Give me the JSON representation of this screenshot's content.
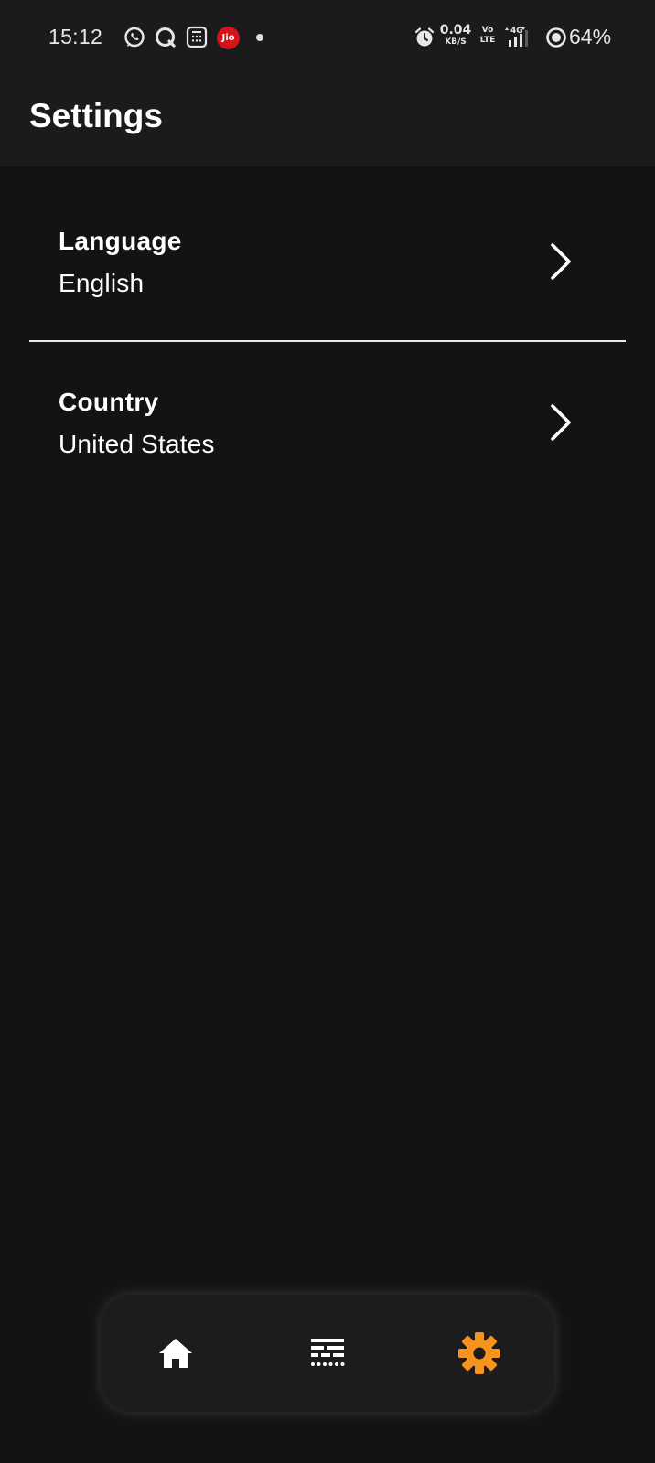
{
  "status_bar": {
    "time": "15:12",
    "notification_icons": [
      "whatsapp-icon",
      "search-app-icon",
      "calculator-app-icon",
      "jio-icon"
    ],
    "jio_label": "Jio",
    "net_speed_value": "0.04",
    "net_speed_unit": "KB/S",
    "volte_top": "Vo",
    "volte_bottom": "LTE",
    "network_type": "4G",
    "battery_percent": "64%"
  },
  "header": {
    "title": "Settings"
  },
  "settings": {
    "items": [
      {
        "label": "Language",
        "value": "English"
      },
      {
        "label": "Country",
        "value": "United States"
      }
    ]
  },
  "bottom_nav": {
    "items": [
      {
        "icon": "home-icon",
        "active": false
      },
      {
        "icon": "list-icon",
        "active": false
      },
      {
        "icon": "gear-icon",
        "active": true
      }
    ],
    "active_color": "#f7941d",
    "inactive_color": "#ffffff"
  },
  "colors": {
    "background": "#131313",
    "header_background": "#1b1b1b",
    "nav_background": "#1c1c1c"
  }
}
